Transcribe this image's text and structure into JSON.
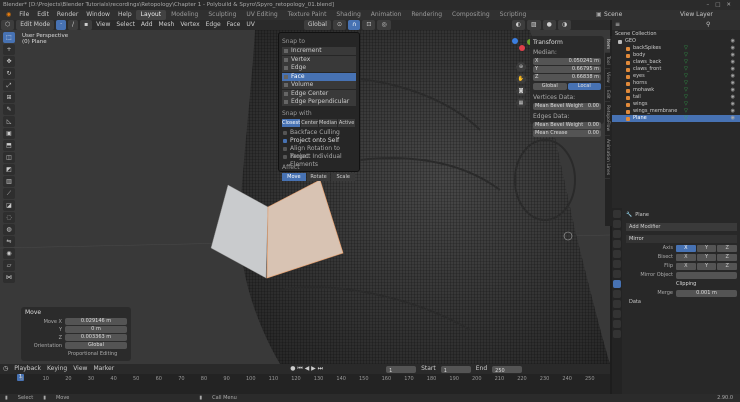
{
  "titlebar": {
    "text": "Blender* [D:\\Projects\\Blender Tutorials\\recordings\\Retopology\\Chapter 1 - Polybuild & Spyro\\Spyro_retopology_01.blend]"
  },
  "menubar": {
    "menus": [
      "File",
      "Edit",
      "Render",
      "Window",
      "Help"
    ],
    "workspaces": [
      "Layout",
      "Modeling",
      "Sculpting",
      "UV Editing",
      "Texture Paint",
      "Shading",
      "Animation",
      "Rendering",
      "Compositing",
      "Scripting"
    ],
    "active_workspace": "Layout",
    "scene": "Scene",
    "view_layer": "View Layer"
  },
  "viewport_header": {
    "mode": "Edit Mode",
    "menus": [
      "View",
      "Select",
      "Add",
      "Mesh",
      "Vertex",
      "Edge",
      "Face",
      "UV"
    ],
    "orientation": "Global"
  },
  "viewport": {
    "view": "User Perspective",
    "object": "(0) Plane"
  },
  "snap_popup": {
    "snap_to_label": "Snap to",
    "snap_to": [
      "Increment",
      "Vertex",
      "Edge",
      "Face",
      "Volume",
      "Edge Center",
      "Edge Perpendicular"
    ],
    "active_snap": "Face",
    "snap_with_label": "Snap with",
    "snap_with": [
      "Closest",
      "Center",
      "Median",
      "Active"
    ],
    "active_with": "Closest",
    "options": [
      {
        "label": "Backface Culling",
        "checked": false
      },
      {
        "label": "Project onto Self",
        "checked": true
      },
      {
        "label": "Align Rotation to Target",
        "checked": false
      },
      {
        "label": "Project Individual Elements",
        "checked": false
      }
    ],
    "affect_label": "Affect",
    "affect": [
      "Move",
      "Rotate",
      "Scale"
    ],
    "active_affect": "Move"
  },
  "transform_panel": {
    "title": "Transform",
    "median_label": "Median:",
    "x": "0.050241 m",
    "y": "0.66795 m",
    "z": "0.66838 m",
    "space": [
      "Global",
      "Local"
    ],
    "active_space": "Local",
    "vertices_data": "Vertices Data:",
    "vertex_bevel": "Mean Bevel Weight",
    "vertex_bevel_val": "0.00",
    "edges_data": "Edges Data:",
    "edge_bevel": "Mean Bevel Weight",
    "edge_bevel_val": "0.00",
    "crease": "Mean Crease",
    "crease_val": "0.00"
  },
  "side_tabs": [
    "Item",
    "Tool",
    "View",
    "Edit",
    "RetopoFlow",
    "Animation Lines"
  ],
  "operator_panel": {
    "title": "Move",
    "move_x_label": "Move X",
    "move_x": "0.029146 m",
    "y_label": "Y",
    "y": "0 m",
    "z_label": "Z",
    "z": "0.003363 m",
    "orientation_label": "Orientation",
    "orientation": "Global",
    "prop_edit": "Proportional Editing"
  },
  "timeline": {
    "menus": [
      "Playback",
      "Keying",
      "View",
      "Marker"
    ],
    "current_frame": "1",
    "start_label": "Start",
    "start": "1",
    "end_label": "End",
    "end": "250",
    "ticks": [
      "0",
      "10",
      "20",
      "30",
      "40",
      "50",
      "60",
      "70",
      "80",
      "90",
      "100",
      "110",
      "120",
      "130",
      "140",
      "150",
      "160",
      "170",
      "180",
      "190",
      "200",
      "210",
      "220",
      "230",
      "240",
      "250"
    ]
  },
  "statusbar": {
    "select": "Select",
    "move": "Move",
    "menu": "Call Menu",
    "version": "2.90.0"
  },
  "outliner": {
    "title": "Scene Collection",
    "items": [
      {
        "name": "GEO",
        "type": "collection"
      },
      {
        "name": "backSpikes",
        "type": "mesh"
      },
      {
        "name": "body",
        "type": "mesh"
      },
      {
        "name": "claws_back",
        "type": "mesh"
      },
      {
        "name": "claws_front",
        "type": "mesh"
      },
      {
        "name": "eyes",
        "type": "mesh"
      },
      {
        "name": "horns",
        "type": "mesh"
      },
      {
        "name": "mohawk",
        "type": "mesh"
      },
      {
        "name": "tail",
        "type": "mesh"
      },
      {
        "name": "wings",
        "type": "mesh"
      },
      {
        "name": "wings_membrane",
        "type": "mesh"
      },
      {
        "name": "Plane",
        "type": "mesh",
        "selected": true
      }
    ]
  },
  "properties": {
    "object": "Plane",
    "add_modifier": "Add Modifier",
    "modifier": "Mirror",
    "axis_label": "Axis",
    "bisect_label": "Bisect",
    "flip_label": "Flip",
    "axes": [
      "X",
      "Y",
      "Z"
    ],
    "mirror_object_label": "Mirror Object",
    "clipping_label": "Clipping",
    "merge_label": "Merge",
    "merge": "0.001 m",
    "data_label": "Data"
  },
  "colors": {
    "accent": "#4772b3",
    "plane": "#d8c3b3"
  }
}
